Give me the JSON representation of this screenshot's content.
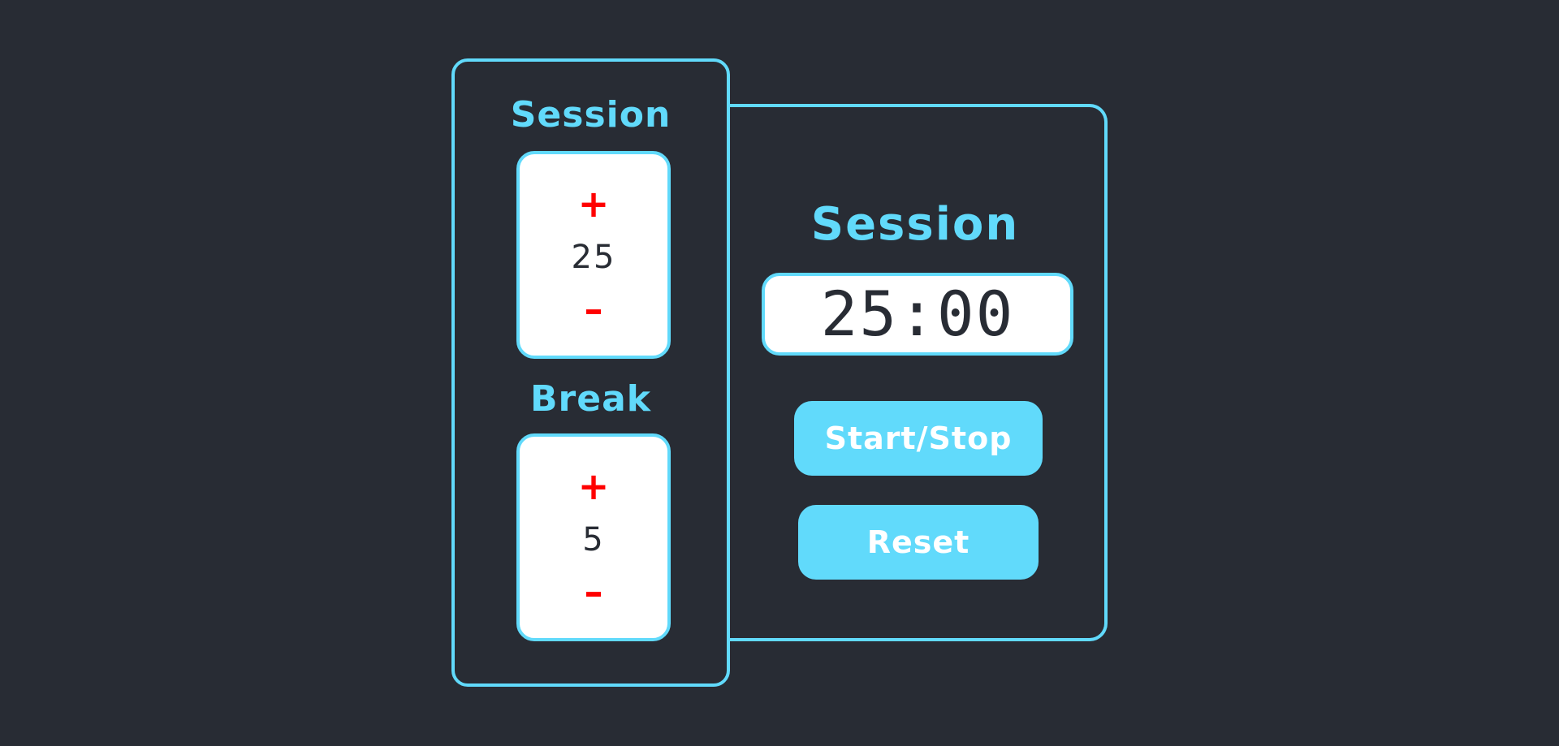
{
  "settings": {
    "session": {
      "label": "Session",
      "increment": "+",
      "value": "25",
      "decrement": "–"
    },
    "break": {
      "label": "Break",
      "increment": "+",
      "value": "5",
      "decrement": "–"
    }
  },
  "timer": {
    "label": "Session",
    "display": "25:00"
  },
  "controls": {
    "start_stop": "Start/Stop",
    "reset": "Reset"
  },
  "colors": {
    "background": "#282c34",
    "accent": "#61dafb",
    "adjust": "#ff0000",
    "card": "#ffffff"
  }
}
